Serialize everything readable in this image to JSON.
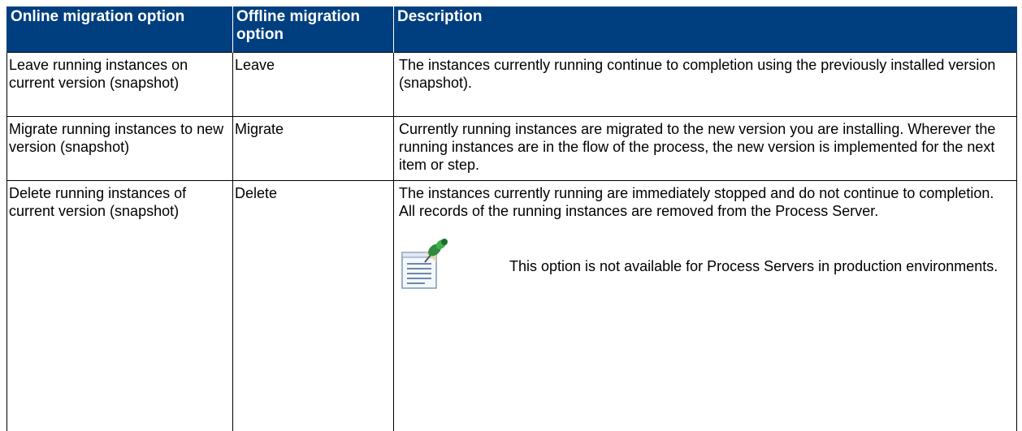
{
  "table": {
    "headers": [
      "Online migration option",
      "Offline migration option",
      "Description"
    ],
    "rows": [
      {
        "online": "Leave running instances on current version (snapshot)",
        "offline": "Leave",
        "description": "The instances currently running continue to completion using the previously installed version (snapshot)."
      },
      {
        "online": "Migrate running instances to new version (snapshot)",
        "offline": "Migrate",
        "description": "Currently running instances are migrated to the new version you are installing. Wherever the running instances are in the flow of the process, the new version is implemented for the next item or step."
      },
      {
        "online": "Delete running instances of current version (snapshot)",
        "offline": "Delete",
        "description": "The instances currently running are immediately stopped and do not continue to completion. All records of the running instances are removed from the Process Server.",
        "note": {
          "icon": "note-pin-icon",
          "text": "This option is not available for Process Servers in production environments."
        }
      }
    ]
  },
  "colors": {
    "header_bg": "#003f7f",
    "header_text": "#ffffff",
    "border": "#000000"
  }
}
